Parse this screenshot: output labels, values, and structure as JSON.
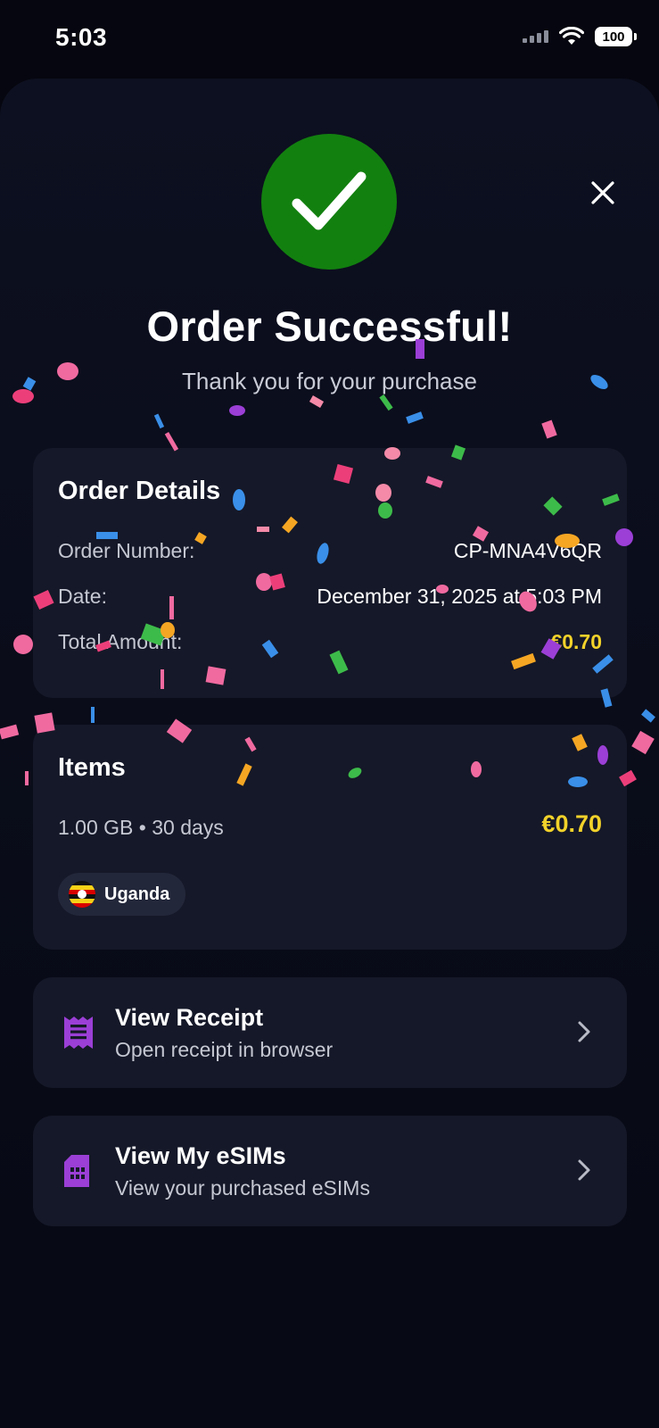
{
  "status_bar": {
    "time": "5:03",
    "battery": "100"
  },
  "header": {
    "title": "Order Successful!",
    "subtitle": "Thank you for your purchase"
  },
  "order_details": {
    "title": "Order Details",
    "rows": [
      {
        "label": "Order Number:",
        "value": "CP-MNA4V6QR"
      },
      {
        "label": "Date:",
        "value": "December 31, 2025 at 5:03 PM"
      },
      {
        "label": "Total Amount:",
        "value": "€0.70"
      }
    ]
  },
  "items": {
    "title": "Items",
    "description": "1.00 GB • 30 days",
    "price": "€0.70",
    "country": "Uganda"
  },
  "actions": [
    {
      "title": "View Receipt",
      "subtitle": "Open receipt in browser",
      "icon": "receipt-icon"
    },
    {
      "title": "View My eSIMs",
      "subtitle": "View your purchased eSIMs",
      "icon": "sim-card-icon"
    }
  ],
  "colors": {
    "success": "#12800f",
    "accent": "#9b3fd6",
    "price": "#f2d22a",
    "card": "#151828",
    "background": "#05060f"
  }
}
